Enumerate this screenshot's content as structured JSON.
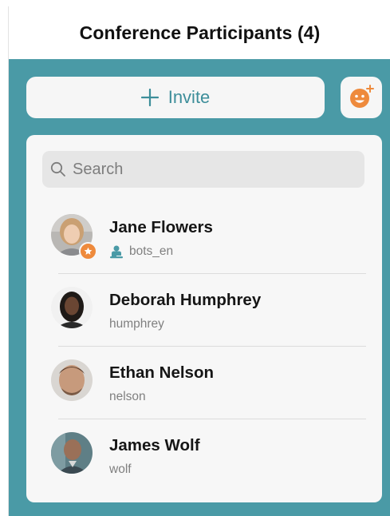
{
  "header": {
    "title": "Conference Participants (4)"
  },
  "actions": {
    "invite_label": "Invite"
  },
  "search": {
    "placeholder": "Search"
  },
  "participants": [
    {
      "name": "Jane Flowers",
      "username": "bots_en",
      "moderator": true,
      "bot": true
    },
    {
      "name": "Deborah Humphrey",
      "username": "humphrey"
    },
    {
      "name": "Ethan Nelson",
      "username": "nelson"
    },
    {
      "name": "James Wolf",
      "username": "wolf"
    }
  ],
  "colors": {
    "teal_background": "#4a9aa6",
    "accent": "#3d8e9a",
    "badge_orange": "#ee8a3c",
    "card_background": "#f7f7f7"
  },
  "icons": {
    "invite": "plus-icon",
    "emoji": "add-emoji-icon",
    "search": "search-icon",
    "moderator": "star-badge-icon",
    "bot": "bot-icon"
  }
}
